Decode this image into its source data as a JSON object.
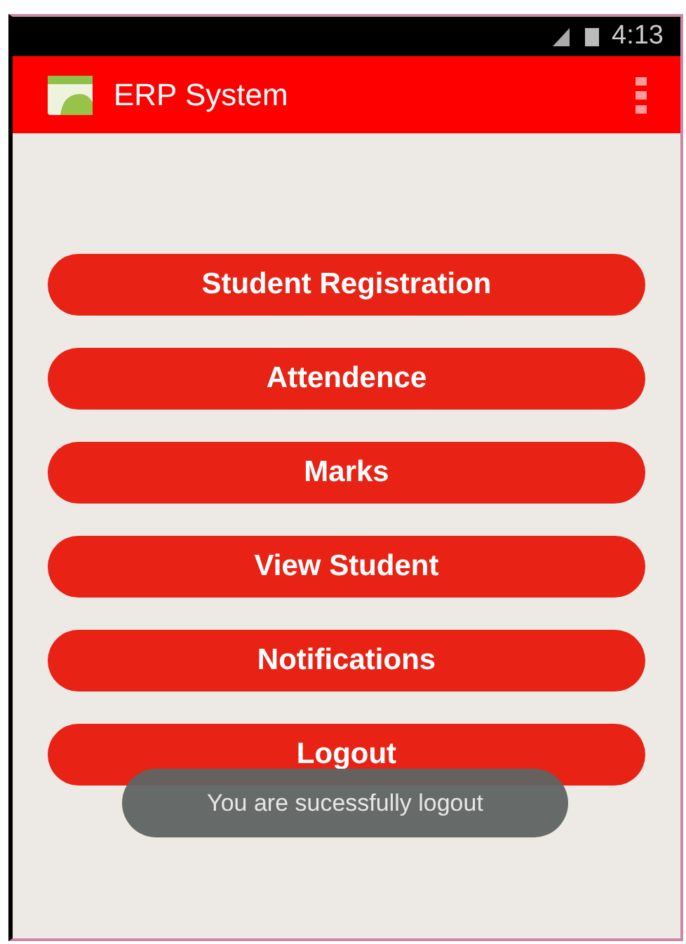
{
  "status_bar": {
    "time": "4:13"
  },
  "app_bar": {
    "title": "ERP System"
  },
  "menu_buttons": [
    {
      "label": "Student Registration"
    },
    {
      "label": "Attendence"
    },
    {
      "label": "Marks"
    },
    {
      "label": "View Student"
    },
    {
      "label": "Notifications"
    },
    {
      "label": "Logout"
    }
  ],
  "toast": {
    "message": "You are sucessfully logout"
  }
}
